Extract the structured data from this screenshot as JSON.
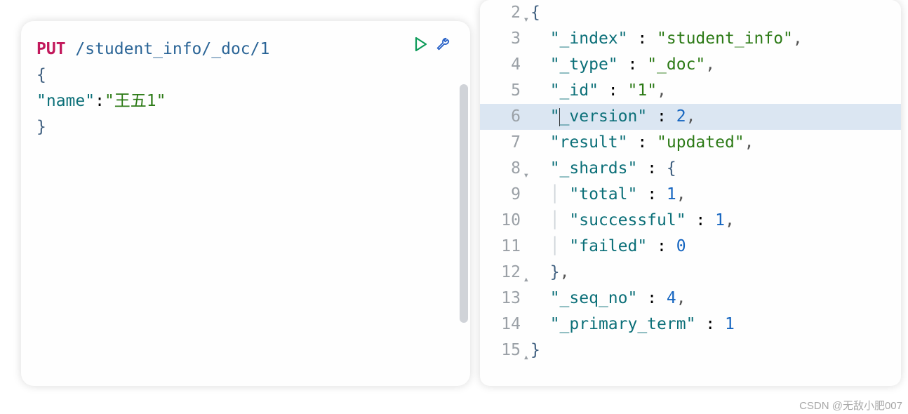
{
  "left": {
    "method": "PUT",
    "endpoint": " /student_info/_doc/1",
    "body_open": "{",
    "field_key": "\"name\"",
    "field_colon": ":",
    "field_value": "\"王五1\"",
    "body_close": "}"
  },
  "right": {
    "lines": [
      {
        "n": "2",
        "fold": "▾",
        "tokens": [
          {
            "t": "{",
            "c": "brace"
          }
        ]
      },
      {
        "n": "3",
        "tokens": [
          {
            "t": "  ",
            "c": ""
          },
          {
            "t": "\"_index\"",
            "c": "key"
          },
          {
            "t": " : ",
            "c": "colon"
          },
          {
            "t": "\"student_info\"",
            "c": "str"
          },
          {
            "t": ",",
            "c": "punc"
          }
        ]
      },
      {
        "n": "4",
        "tokens": [
          {
            "t": "  ",
            "c": ""
          },
          {
            "t": "\"_type\"",
            "c": "key"
          },
          {
            "t": " : ",
            "c": "colon"
          },
          {
            "t": "\"_doc\"",
            "c": "str"
          },
          {
            "t": ",",
            "c": "punc"
          }
        ]
      },
      {
        "n": "5",
        "tokens": [
          {
            "t": "  ",
            "c": ""
          },
          {
            "t": "\"_id\"",
            "c": "key"
          },
          {
            "t": " : ",
            "c": "colon"
          },
          {
            "t": "\"1\"",
            "c": "str"
          },
          {
            "t": ",",
            "c": "punc"
          }
        ]
      },
      {
        "n": "6",
        "hl": true,
        "cursorAfter": 3,
        "tokens": [
          {
            "t": "  ",
            "c": ""
          },
          {
            "t": "\"_version\"",
            "c": "key"
          },
          {
            "t": " : ",
            "c": "colon"
          },
          {
            "t": "2",
            "c": "num"
          },
          {
            "t": ",",
            "c": "punc"
          }
        ]
      },
      {
        "n": "7",
        "tokens": [
          {
            "t": "  ",
            "c": ""
          },
          {
            "t": "\"result\"",
            "c": "key"
          },
          {
            "t": " : ",
            "c": "colon"
          },
          {
            "t": "\"updated\"",
            "c": "str"
          },
          {
            "t": ",",
            "c": "punc"
          }
        ]
      },
      {
        "n": "8",
        "fold": "▾",
        "tokens": [
          {
            "t": "  ",
            "c": ""
          },
          {
            "t": "\"_shards\"",
            "c": "key"
          },
          {
            "t": " : ",
            "c": "colon"
          },
          {
            "t": "{",
            "c": "brace"
          }
        ]
      },
      {
        "n": "9",
        "tokens": [
          {
            "t": "  ",
            "c": ""
          },
          {
            "t": "│ ",
            "c": "indent-guide"
          },
          {
            "t": "\"total\"",
            "c": "key"
          },
          {
            "t": " : ",
            "c": "colon"
          },
          {
            "t": "1",
            "c": "num"
          },
          {
            "t": ",",
            "c": "punc"
          }
        ]
      },
      {
        "n": "10",
        "tokens": [
          {
            "t": "  ",
            "c": ""
          },
          {
            "t": "│ ",
            "c": "indent-guide"
          },
          {
            "t": "\"successful\"",
            "c": "key"
          },
          {
            "t": " : ",
            "c": "colon"
          },
          {
            "t": "1",
            "c": "num"
          },
          {
            "t": ",",
            "c": "punc"
          }
        ]
      },
      {
        "n": "11",
        "tokens": [
          {
            "t": "  ",
            "c": ""
          },
          {
            "t": "│ ",
            "c": "indent-guide"
          },
          {
            "t": "\"failed\"",
            "c": "key"
          },
          {
            "t": " : ",
            "c": "colon"
          },
          {
            "t": "0",
            "c": "num"
          }
        ]
      },
      {
        "n": "12",
        "fold": "▴",
        "tokens": [
          {
            "t": "  ",
            "c": ""
          },
          {
            "t": "}",
            "c": "brace"
          },
          {
            "t": ",",
            "c": "punc"
          }
        ]
      },
      {
        "n": "13",
        "tokens": [
          {
            "t": "  ",
            "c": ""
          },
          {
            "t": "\"_seq_no\"",
            "c": "key"
          },
          {
            "t": " : ",
            "c": "colon"
          },
          {
            "t": "4",
            "c": "num"
          },
          {
            "t": ",",
            "c": "punc"
          }
        ]
      },
      {
        "n": "14",
        "tokens": [
          {
            "t": "  ",
            "c": ""
          },
          {
            "t": "\"_primary_term\"",
            "c": "key"
          },
          {
            "t": " : ",
            "c": "colon"
          },
          {
            "t": "1",
            "c": "num"
          }
        ]
      },
      {
        "n": "15",
        "fold": "▴",
        "tokens": [
          {
            "t": "}",
            "c": "brace"
          }
        ]
      }
    ]
  },
  "watermark": "CSDN @无敌小肥007"
}
